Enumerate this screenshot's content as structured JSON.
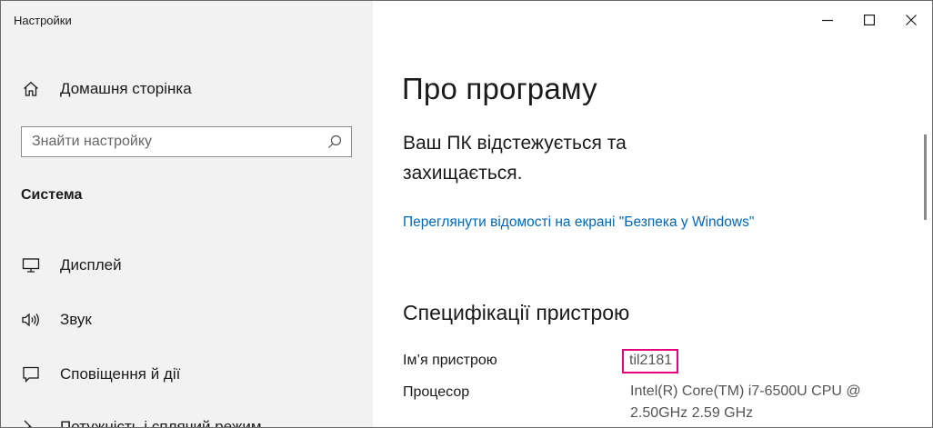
{
  "window": {
    "app_title": "Настройки",
    "controls": {
      "minimize": "minimize-icon",
      "maximize": "maximize-icon",
      "close": "close-icon"
    }
  },
  "sidebar": {
    "home_label": "Домашня сторінка",
    "search": {
      "placeholder": "Знайти настройку",
      "value": ""
    },
    "section_heading": "Система",
    "items": [
      {
        "label": "Дисплей",
        "icon": "display-icon"
      },
      {
        "label": "Звук",
        "icon": "sound-icon"
      },
      {
        "label": "Сповіщення й дії",
        "icon": "notifications-icon"
      },
      {
        "label": "Потужність і сплячий режим",
        "icon": "power-icon"
      }
    ]
  },
  "main": {
    "title": "Про програму",
    "protection_status": "Ваш ПК відстежується та захищається.",
    "security_link": "Переглянути відомості на екрані \"Безпека у Windows\"",
    "specs_title": "Специфікації пристрою",
    "specs": [
      {
        "label": "Ім’я пристрою",
        "value": "til2181"
      },
      {
        "label": "Процесор",
        "value_line1": "Intel(R) Core(TM) i7-6500U CPU @",
        "value_line2": "2.50GHz   2.59 GHz"
      }
    ]
  },
  "colors": {
    "sidebar_bg": "#f2f2f2",
    "link": "#0067b8",
    "highlight_border": "#e4007c"
  }
}
